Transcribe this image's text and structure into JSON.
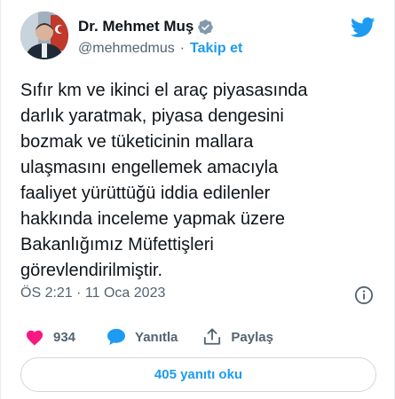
{
  "tweet": {
    "author": {
      "display_name": "Dr. Mehmet Muş",
      "handle": "@mehmedmus",
      "separator": "·",
      "follow_label": "Takip et",
      "verified": true
    },
    "text": "Sıfır km ve ikinci el araç piyasasında\ndarlık yaratmak, piyasa dengesini\nbozmak ve tüketicinin mallara\nulaşmasını engellemek amacıyla\nfaaliyet yürüttüğü iddia edilenler\nhakkında inceleme yapmak üzere\nBakanlığımız Müfettişleri\ngörevlendirilmiştir.",
    "timestamp": "ÖS 2:21 · 11 Oca 2023",
    "actions": {
      "like_count": "934",
      "reply_label": "Yanıtla",
      "share_label": "Paylaş"
    },
    "replies_button": "405 yanıtı oku"
  },
  "colors": {
    "accent": "#1d9bf0",
    "like": "#f91880",
    "text": "#0f1419",
    "muted": "#536471"
  },
  "icons": {
    "brand": "twitter-bird-icon",
    "verified": "verified-badge-icon",
    "info": "info-icon",
    "like": "heart-icon",
    "reply": "speech-bubble-icon",
    "share": "share-icon"
  }
}
